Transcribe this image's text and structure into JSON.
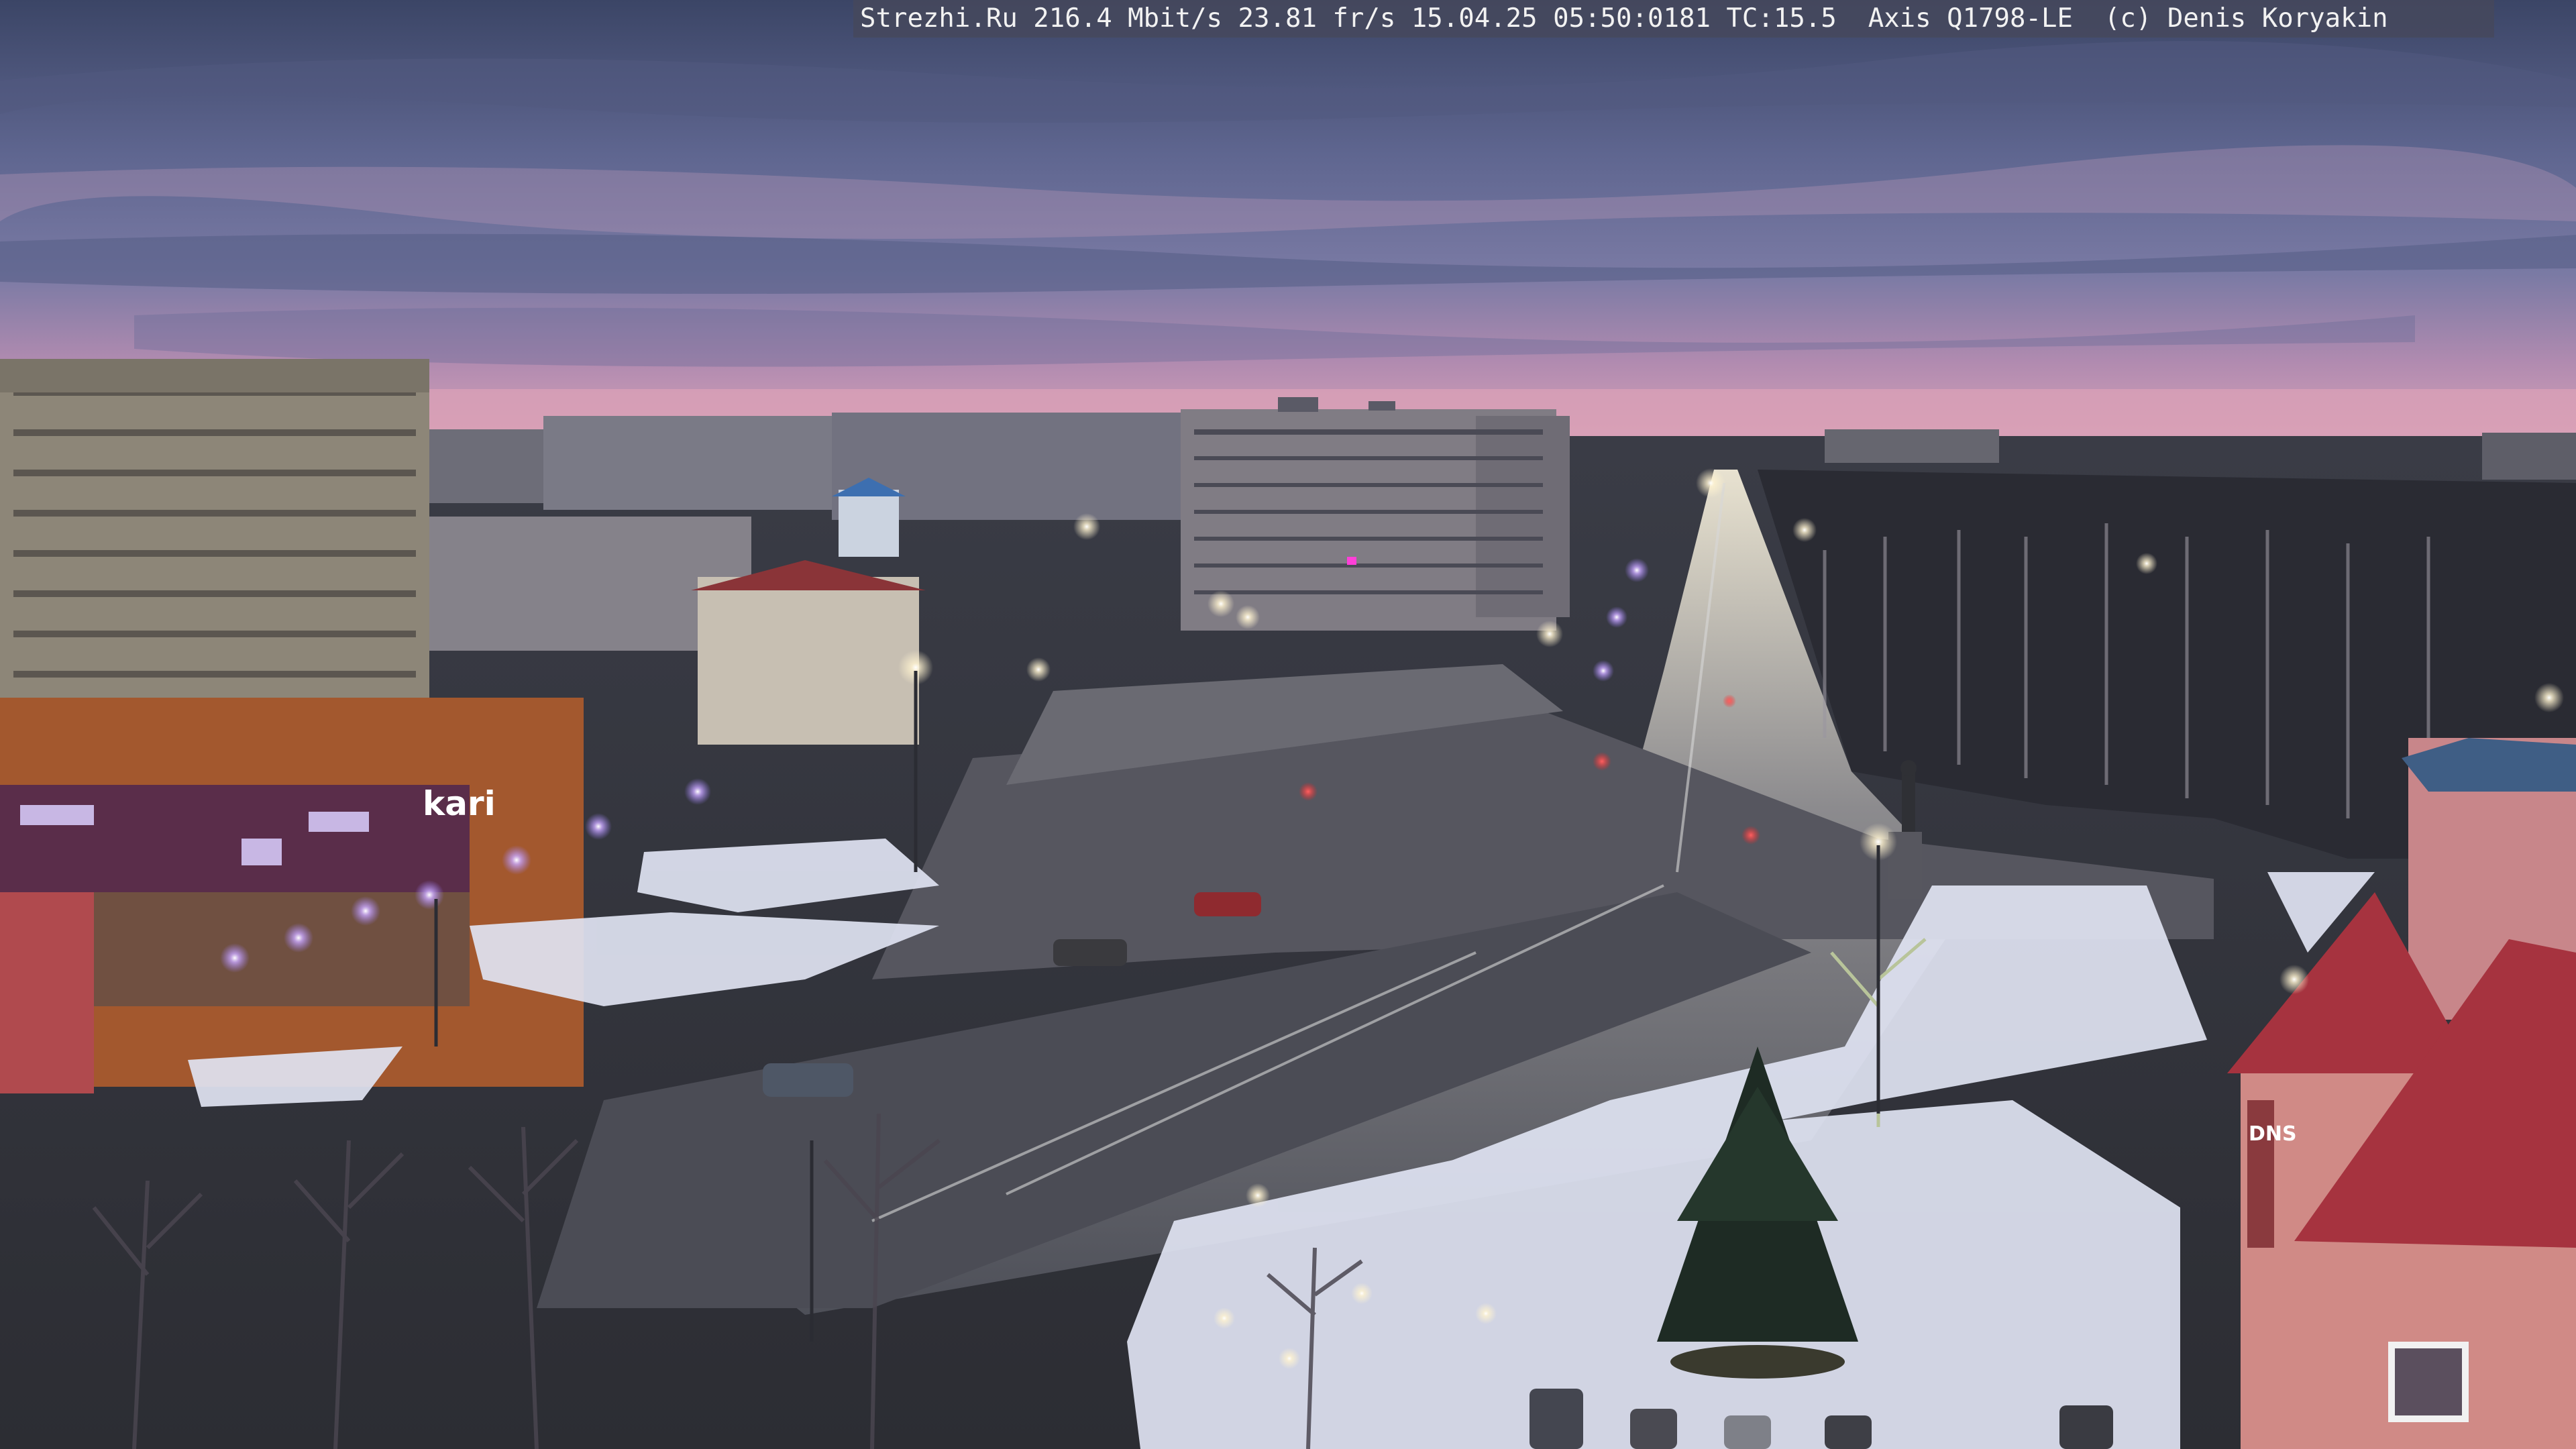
{
  "overlay": {
    "text": "Strezhi.Ru 216.4 Mbit/s 23.81 fr/s 15.04.25 05:50:0181 TC:15.5  Axis Q1798-LE  (c) Denis Koryakin"
  },
  "signs": {
    "store_left": "kari",
    "store_right": "DNS"
  },
  "colors": {
    "sky_top": "#3d4768",
    "sky_mid": "#6c6f96",
    "sky_glow": "#d39ab4",
    "street_light": "#fff6d8",
    "snow": "#dfe3f2",
    "road": "#4d4f5a",
    "roof_red": "#a6333f"
  }
}
